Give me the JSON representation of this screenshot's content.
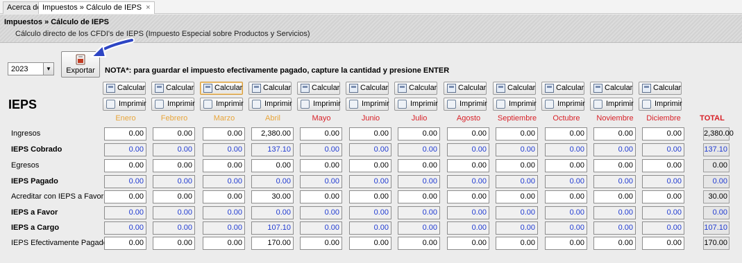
{
  "tabs": [
    {
      "label": "Acerca de",
      "active": false
    },
    {
      "label": "Impuestos » Cálculo de IEPS",
      "active": true,
      "close": "×"
    }
  ],
  "header": {
    "title": "Impuestos » Cálculo de IEPS",
    "subtitle": "Cálculo directo de los CFDI's de IEPS (Impuesto Especial sobre Productos y Servicios)"
  },
  "toolbar": {
    "year": "2023",
    "export_label": "Exportar",
    "nota": "NOTA*: para guardar el impuesto efectivamente pagado, capture la cantidad y presione ENTER"
  },
  "section_title": "IEPS",
  "buttons": {
    "calc_label": "Calcular",
    "print_label": "Imprimir"
  },
  "months": [
    "Enero",
    "Febrero",
    "Marzo",
    "Abril",
    "Mayo",
    "Junio",
    "Julio",
    "Agosto",
    "Septiembre",
    "Octubre",
    "Noviembre",
    "Diciembre"
  ],
  "total_label": "TOTAL",
  "colors": {
    "month_past": "#e8a53a",
    "month_future": "#d81f26",
    "value_blue": "#1f3ad1",
    "selected_outline": "#d49a3c"
  },
  "rows": [
    {
      "label": "Ingresos",
      "bold": false,
      "values": [
        "0.00",
        "0.00",
        "0.00",
        "2,380.00",
        "0.00",
        "0.00",
        "0.00",
        "0.00",
        "0.00",
        "0.00",
        "0.00",
        "0.00"
      ],
      "total": "2,380.00"
    },
    {
      "label": "IEPS Cobrado",
      "bold": true,
      "values": [
        "0.00",
        "0.00",
        "0.00",
        "137.10",
        "0.00",
        "0.00",
        "0.00",
        "0.00",
        "0.00",
        "0.00",
        "0.00",
        "0.00"
      ],
      "total": "137.10"
    },
    {
      "label": "Egresos",
      "bold": false,
      "values": [
        "0.00",
        "0.00",
        "0.00",
        "0.00",
        "0.00",
        "0.00",
        "0.00",
        "0.00",
        "0.00",
        "0.00",
        "0.00",
        "0.00"
      ],
      "total": "0.00"
    },
    {
      "label": "IEPS Pagado",
      "bold": true,
      "values": [
        "0.00",
        "0.00",
        "0.00",
        "0.00",
        "0.00",
        "0.00",
        "0.00",
        "0.00",
        "0.00",
        "0.00",
        "0.00",
        "0.00"
      ],
      "total": "0.00"
    },
    {
      "label": "Acreditar con IEPS a Favor",
      "bold": false,
      "values": [
        "0.00",
        "0.00",
        "0.00",
        "30.00",
        "0.00",
        "0.00",
        "0.00",
        "0.00",
        "0.00",
        "0.00",
        "0.00",
        "0.00"
      ],
      "total": "30.00"
    },
    {
      "label": "IEPS a Favor",
      "bold": true,
      "values": [
        "0.00",
        "0.00",
        "0.00",
        "0.00",
        "0.00",
        "0.00",
        "0.00",
        "0.00",
        "0.00",
        "0.00",
        "0.00",
        "0.00"
      ],
      "total": "0.00"
    },
    {
      "label": "IEPS a Cargo",
      "bold": true,
      "values": [
        "0.00",
        "0.00",
        "0.00",
        "107.10",
        "0.00",
        "0.00",
        "0.00",
        "0.00",
        "0.00",
        "0.00",
        "0.00",
        "0.00"
      ],
      "total": "107.10"
    },
    {
      "label": "IEPS Efectivamente Pagado",
      "bold": false,
      "values": [
        "0.00",
        "0.00",
        "0.00",
        "170.00",
        "0.00",
        "0.00",
        "0.00",
        "0.00",
        "0.00",
        "0.00",
        "0.00",
        "0.00"
      ],
      "total": "170.00"
    }
  ]
}
